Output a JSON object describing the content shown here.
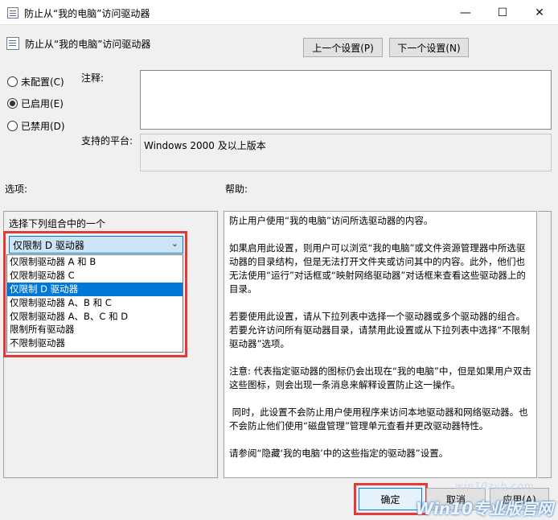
{
  "window": {
    "title": "防止从“我的电脑”访问驱动器",
    "minimize": "—",
    "maximize": "☐",
    "close": "✕"
  },
  "header": {
    "policy_name": "防止从“我的电脑”访问驱动器",
    "prev_button": "上一个设置(P)",
    "next_button": "下一个设置(N)"
  },
  "state": {
    "options": [
      {
        "label": "未配置(C)",
        "checked": false
      },
      {
        "label": "已启用(E)",
        "checked": true
      },
      {
        "label": "已禁用(D)",
        "checked": false
      }
    ]
  },
  "comment": {
    "label": "注释:",
    "value": ""
  },
  "platform": {
    "label": "支持的平台:",
    "value": "Windows 2000 及以上版本"
  },
  "options_section": {
    "label": "选项:",
    "select_label": "选择下列组合中的一个",
    "selected": "仅限制 D 驱动器",
    "items": [
      "仅限制驱动器 A 和 B",
      "仅限制驱动器 C",
      "仅限制 D 驱动器",
      "仅限制驱动器 A、B 和 C",
      "仅限制驱动器 A、B、C 和 D",
      "限制所有驱动器",
      "不限制驱动器"
    ],
    "selected_index": 2
  },
  "help_section": {
    "label": "帮助:",
    "paragraphs": [
      "防止用户使用“我的电脑”访问所选驱动器的内容。",
      "如果启用此设置，则用户可以浏览“我的电脑”或文件资源管理器中所选驱动器的目录结构，但是无法打开文件夹或访问其中的内容。此外，他们也无法使用“运行”对话框或“映射网络驱动器”对话框来查看这些驱动器上的目录。",
      "若要使用此设置，请从下拉列表中选择一个驱动器或多个驱动器的组合。若要允许访问所有驱动器目录，请禁用此设置或从下拉列表中选择“不限制驱动器”选项。",
      "注意: 代表指定驱动器的图标仍会出现在“我的电脑”中，但是如果用户双击这些图标，则会出现一条消息来解释设置防止这一操作。",
      " 同时，此设置不会防止用户使用程序来访问本地驱动器和网络驱动器。也不会防止他们使用“磁盘管理”管理单元查看并更改驱动器特性。",
      "请参阅“隐藏‘我的电脑’中的这些指定的驱动器”设置。"
    ]
  },
  "footer": {
    "ok": "确定",
    "cancel": "取消",
    "apply": "应用(A)"
  },
  "watermark": {
    "line1": "win10zyb.com",
    "line2": "Win10专业版官网"
  }
}
